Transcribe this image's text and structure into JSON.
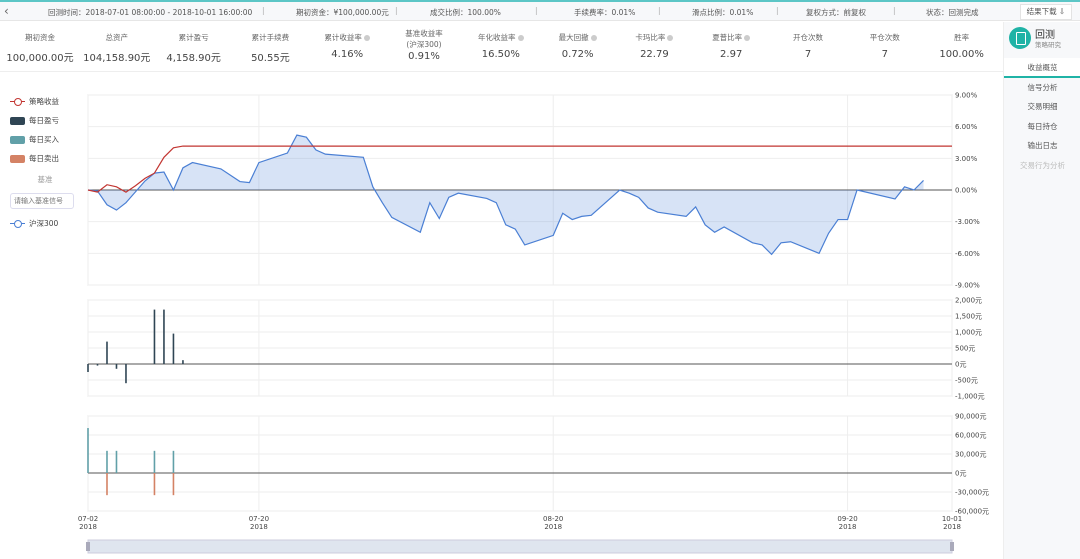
{
  "topbar": {
    "back_icon": "chevron-left-icon",
    "period": "回测时间：2018-07-01 08:00:00 - 2018-10-01 16:00:00",
    "capital": "期初资金：¥100,000.00元",
    "fill_ratio": "成交比例：100.00%",
    "fee": "手续费率：0.01%",
    "slippage": "滑点比例：0.01%",
    "adjust": "复权方式：前复权",
    "status": "状态：回测完成",
    "download": "结果下载"
  },
  "stats": [
    {
      "label": "期初资金",
      "value": "100,000.00元"
    },
    {
      "label": "总资产",
      "value": "104,158.90元"
    },
    {
      "label": "累计盈亏",
      "value": "4,158.90元"
    },
    {
      "label": "累计手续费",
      "value": "50.55元"
    },
    {
      "label": "累计收益率",
      "value": "4.16%",
      "info": true
    },
    {
      "label": "基准收益率",
      "sub": "(沪深300)",
      "value": "0.91%"
    },
    {
      "label": "年化收益率",
      "value": "16.50%",
      "info": true
    },
    {
      "label": "最大回撤",
      "value": "0.72%",
      "info": true
    },
    {
      "label": "卡玛比率",
      "value": "22.79",
      "info": true
    },
    {
      "label": "夏普比率",
      "value": "2.97",
      "info": true
    },
    {
      "label": "开仓次数",
      "value": "7"
    },
    {
      "label": "平仓次数",
      "value": "7"
    },
    {
      "label": "胜率",
      "value": "100.00%"
    }
  ],
  "sidebar": {
    "title": "回测",
    "subtitle": "策略研究",
    "items": [
      "收益概览",
      "信号分析",
      "交易明细",
      "每日持仓",
      "输出日志",
      "交易行为分析"
    ],
    "active": 0
  },
  "legend": {
    "strategy": "策略收益",
    "daily_pnl": "每日盈亏",
    "daily_buy": "每日买入",
    "daily_sell": "每日卖出",
    "benchmark_title": "基准",
    "benchmark_placeholder": "请输入基准信号",
    "benchmark": "沪深300"
  },
  "colors": {
    "strategy": "#c23531",
    "benchmark": "#4a7fd4",
    "pnl": "#2f4554",
    "buy": "#61a0a8",
    "sell": "#d48265",
    "accent": "#1fb3a6"
  },
  "chart_data": [
    {
      "type": "line",
      "ylim": [
        -9,
        9
      ],
      "yticks": [
        "9.00%",
        "6.00%",
        "3.00%",
        "0.00%",
        "-3.00%",
        "-6.00%",
        "-9.00%"
      ],
      "ytick_values": [
        9,
        6,
        3,
        0,
        -3,
        -6,
        -9
      ],
      "series": [
        {
          "name": "策略收益",
          "x": [
            "07-02",
            "07-03",
            "07-04",
            "07-05",
            "07-06",
            "07-07",
            "07-08",
            "07-09",
            "07-10",
            "07-11",
            "07-12",
            "10-01"
          ],
          "y": [
            0,
            -0.2,
            0.5,
            0.3,
            -0.2,
            0.4,
            1.1,
            1.6,
            3.1,
            4.0,
            4.16,
            4.16
          ]
        },
        {
          "name": "沪深300",
          "x": [
            "07-02",
            "07-03",
            "07-04",
            "07-05",
            "07-06",
            "07-08",
            "07-09",
            "07-10",
            "07-11",
            "07-12",
            "07-13",
            "07-16",
            "07-18",
            "07-19",
            "07-20",
            "07-23",
            "07-24",
            "07-25",
            "07-26",
            "07-27",
            "07-31",
            "08-01",
            "08-02",
            "08-03",
            "08-06",
            "08-07",
            "08-08",
            "08-09",
            "08-10",
            "08-13",
            "08-14",
            "08-15",
            "08-16",
            "08-17",
            "08-20",
            "08-21",
            "08-22",
            "08-23",
            "08-24",
            "08-27",
            "08-28",
            "08-29",
            "08-30",
            "08-31",
            "09-03",
            "09-04",
            "09-05",
            "09-06",
            "09-07",
            "09-10",
            "09-11",
            "09-12",
            "09-13",
            "09-14",
            "09-17",
            "09-18",
            "09-19",
            "09-20",
            "09-21",
            "09-25",
            "09-26",
            "09-27",
            "09-28"
          ],
          "y": [
            0,
            -0.1,
            -1.4,
            -1.9,
            -1.2,
            0.85,
            1.6,
            1.7,
            0,
            2.1,
            2.6,
            2.0,
            0.8,
            0.7,
            2.6,
            3.5,
            5.2,
            5.0,
            3.8,
            3.4,
            3.1,
            0.3,
            -1.2,
            -2.6,
            -4.0,
            -1.2,
            -2.7,
            -0.7,
            -0.3,
            -0.8,
            -1.2,
            -3.3,
            -3.7,
            -5.2,
            -4.3,
            -2.2,
            -2.8,
            -2.5,
            -2.4,
            0,
            -0.3,
            -0.7,
            -1.7,
            -2.1,
            -2.5,
            -1.6,
            -3.3,
            -4.0,
            -3.5,
            -5.0,
            -5.2,
            -6.1,
            -5.0,
            -4.9,
            -6.0,
            -4.1,
            -2.8,
            -2.8,
            0,
            -0.85,
            0.3,
            0,
            0.91
          ]
        }
      ]
    },
    {
      "type": "bar",
      "name": "每日盈亏",
      "ylim": [
        -1000,
        2000
      ],
      "yticks": [
        "2,000元",
        "1,500元",
        "1,000元",
        "500元",
        "0元",
        "-500元",
        "-1,000元"
      ],
      "ytick_values": [
        2000,
        1500,
        1000,
        500,
        0,
        -500,
        -1000
      ],
      "x": [
        "07-02",
        "07-03",
        "07-04",
        "07-05",
        "07-06",
        "07-09",
        "07-10",
        "07-11",
        "07-12"
      ],
      "values": [
        -250,
        -50,
        700,
        -150,
        -600,
        1700,
        1700,
        950,
        120
      ]
    },
    {
      "type": "bar",
      "ylim": [
        -60000,
        90000
      ],
      "yticks": [
        "90,000元",
        "60,000元",
        "30,000元",
        "0元",
        "-30,000元",
        "-60,000元"
      ],
      "ytick_values": [
        90000,
        60000,
        30000,
        0,
        -30000,
        -60000
      ],
      "series": [
        {
          "name": "每日买入",
          "x": [
            "07-02",
            "07-04",
            "07-05",
            "07-09",
            "07-11"
          ],
          "values": [
            71000,
            35000,
            35000,
            35000,
            35000
          ]
        },
        {
          "name": "每日卖出",
          "x": [
            "07-04",
            "07-09",
            "07-11"
          ],
          "values": [
            -35000,
            -35000,
            -35000
          ]
        }
      ]
    }
  ],
  "xaxis": {
    "ticks": [
      {
        "date": "07-02",
        "label": "07-02",
        "year": "2018"
      },
      {
        "date": "07-20",
        "label": "07-20",
        "year": "2018"
      },
      {
        "date": "08-20",
        "label": "08-20",
        "year": "2018"
      },
      {
        "date": "09-20",
        "label": "09-20",
        "year": "2018"
      },
      {
        "date": "10-01",
        "label": "10-01",
        "year": "2018"
      }
    ]
  }
}
